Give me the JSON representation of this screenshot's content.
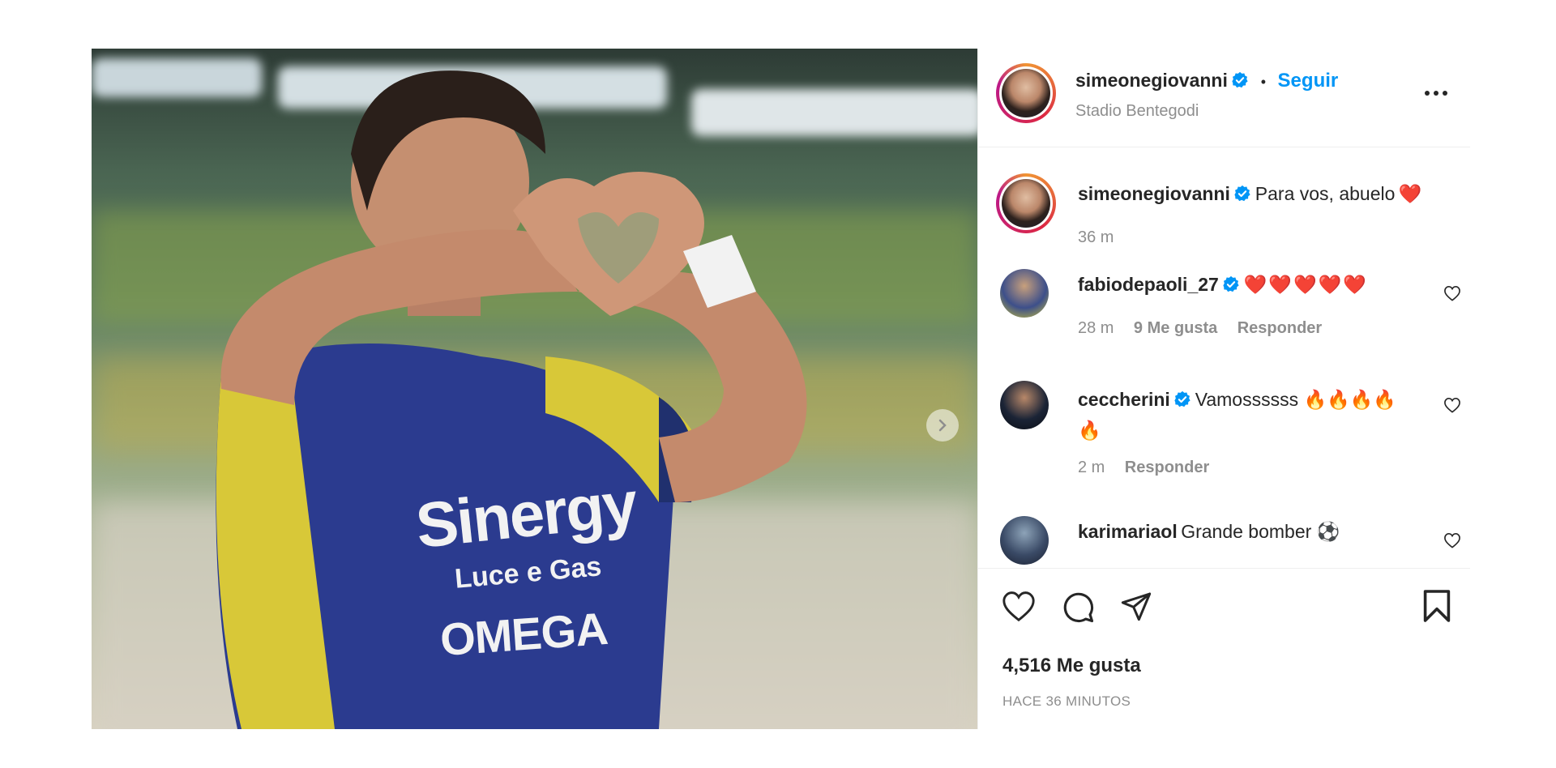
{
  "post": {
    "author": "simeonegiovanni",
    "follow_label": "Seguir",
    "dot": "•",
    "location": "Stadio Bentegodi",
    "caption": "Para vos, abuelo",
    "caption_emoji": "❤️",
    "caption_time": "36 m",
    "image_text": {
      "sponsor_line1": "Sinergy",
      "sponsor_line2": "Luce e Gas",
      "sponsor_logo": "OMEGA"
    }
  },
  "comments": [
    {
      "user": "fabiodepaoli_27",
      "verified": true,
      "text": "❤️❤️❤️❤️❤️",
      "time": "28 m",
      "likes": "9 Me gusta",
      "reply": "Responder"
    },
    {
      "user": "ceccherini",
      "verified": true,
      "text": "Vamossssss 🔥🔥🔥🔥🔥",
      "time": "2 m",
      "reply": "Responder"
    },
    {
      "user": "karimariaol",
      "verified": false,
      "text": "Grande bomber ⚽"
    }
  ],
  "footer": {
    "likes": "4,516 Me gusta",
    "time": "HACE 36 MINUTOS"
  },
  "colors": {
    "accent": "#0095f6",
    "verified": "#0095f6",
    "heart": "#ed4956"
  },
  "icons": [
    "more-icon",
    "heart-icon",
    "comment-icon",
    "share-icon",
    "bookmark-icon",
    "chevron-right-icon",
    "verified-icon"
  ]
}
